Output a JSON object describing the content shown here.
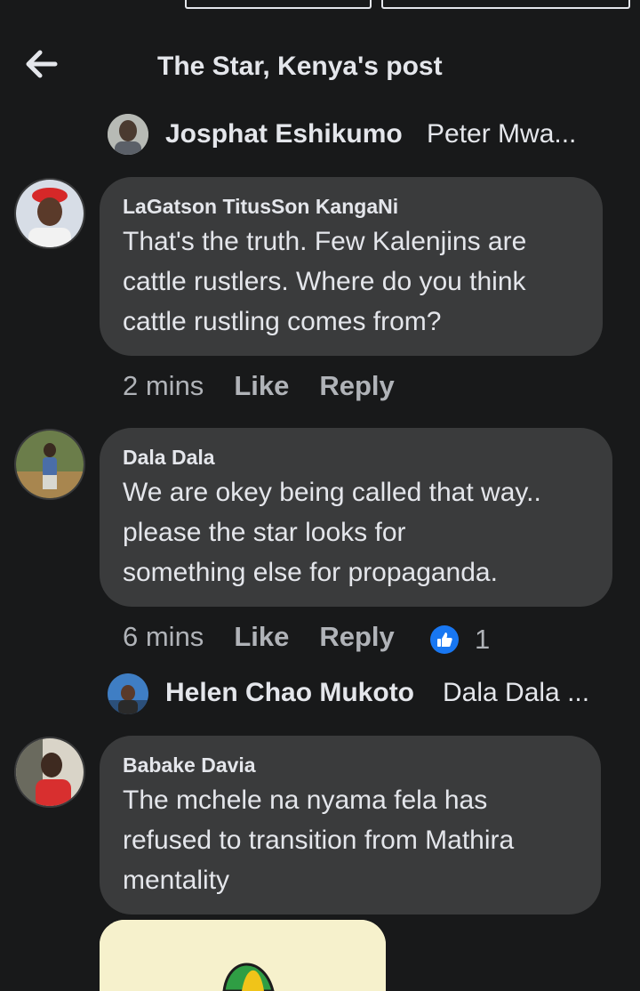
{
  "header": {
    "title": "The Star, Kenya's post"
  },
  "replies": [
    {
      "name": "Josphat Eshikumo",
      "preview": "Peter Mwa..."
    },
    {
      "name": "Helen Chao Mukoto",
      "preview": "Dala Dala ..."
    }
  ],
  "comments": [
    {
      "author": "LaGatson TitusSon KangaNi",
      "text": "That's the truth. Few Kalenjins are\ncattle rustlers. Where do you think\ncattle rustling comes from?",
      "time": "2 mins",
      "like_label": "Like",
      "reply_label": "Reply"
    },
    {
      "author": "Dala Dala",
      "text": "We are okey being called that way..\nplease  the star looks for\nsomething else for propaganda.",
      "time": "6 mins",
      "like_label": "Like",
      "reply_label": "Reply",
      "reaction_count": "1"
    },
    {
      "author": "Babake Davia",
      "text": "The mchele na nyama fela has\nrefused to transition from Mathira\nmentality"
    }
  ],
  "colors": {
    "background": "#18191a",
    "bubble": "#3a3b3c",
    "text": "#e4e6eb",
    "secondary_text": "#b0b3b8",
    "like_blue": "#1877f2"
  },
  "icons": {
    "back": "arrow-left-icon",
    "reaction": "thumbs-up-icon"
  }
}
